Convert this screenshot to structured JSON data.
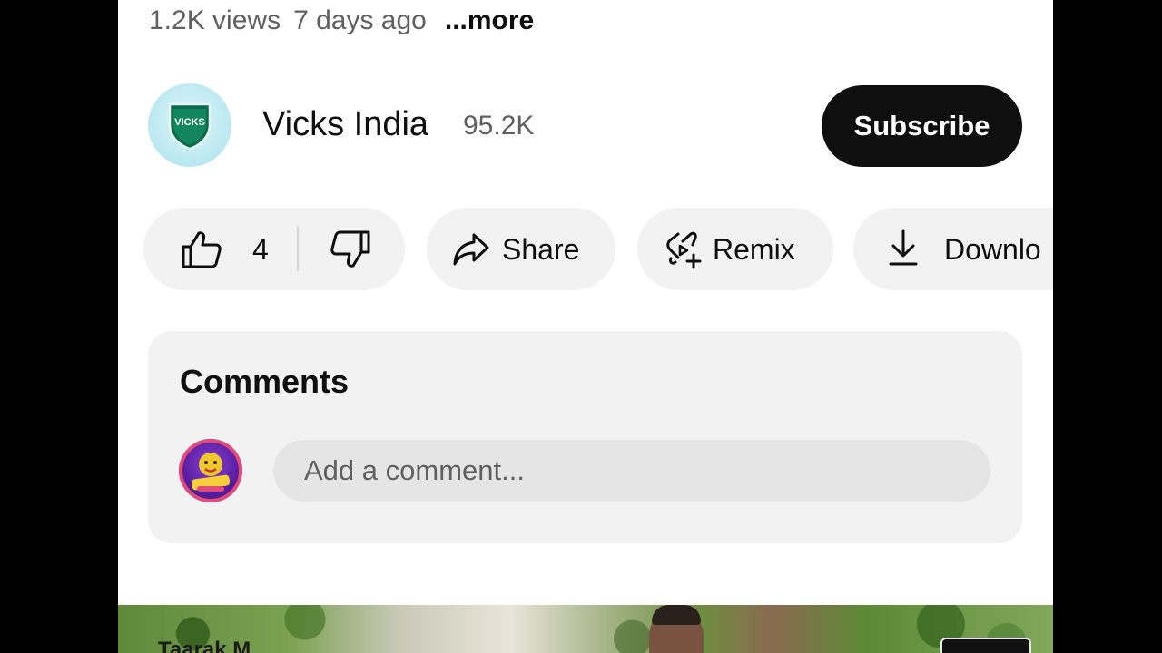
{
  "video_meta": {
    "views": "1.2K views",
    "age": "7 days ago",
    "more_label": "...more"
  },
  "channel": {
    "avatar_text": "VICKS",
    "name": "Vicks India",
    "subscribers": "95.2K",
    "subscribe_label": "Subscribe"
  },
  "actions": {
    "like_count": "4",
    "share_label": "Share",
    "remix_label": "Remix",
    "download_label": "Downlo"
  },
  "comments": {
    "title": "Comments",
    "input_placeholder": "Add a comment..."
  },
  "next_video": {
    "caption_partial": "Taarak M"
  },
  "colors": {
    "subscribe_bg": "#0f0f0f",
    "pill_bg": "#f2f2f2",
    "comment_card_bg": "#f2f2f2",
    "comment_input_bg": "#e5e5e5",
    "secondary_text": "#606060"
  },
  "icons": {
    "like": "thumbs-up-icon",
    "dislike": "thumbs-down-icon",
    "share": "share-arrow-icon",
    "remix": "remix-icon",
    "download": "download-icon"
  }
}
